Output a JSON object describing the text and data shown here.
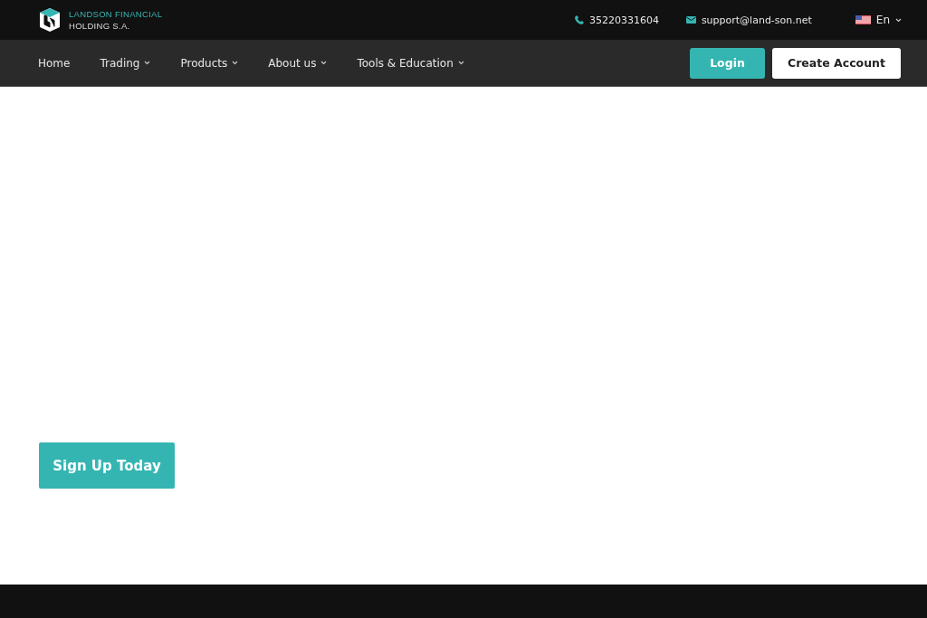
{
  "brand": {
    "line_1": "LANDSON FINANCIAL",
    "line_2": "HOLDING S.A."
  },
  "contact": {
    "phone": "35220331604",
    "email": "support@land-son.net",
    "language": "En"
  },
  "nav": [
    {
      "label": "Home",
      "has_menu": false
    },
    {
      "label": "Trading",
      "has_menu": true
    },
    {
      "label": "Products",
      "has_menu": true
    },
    {
      "label": "About us",
      "has_menu": true
    },
    {
      "label": "Tools & Education",
      "has_menu": true
    }
  ],
  "login_button": "Login",
  "create_account_button": "Create Account",
  "hero": {
    "cta": "Sign Up Today"
  }
}
